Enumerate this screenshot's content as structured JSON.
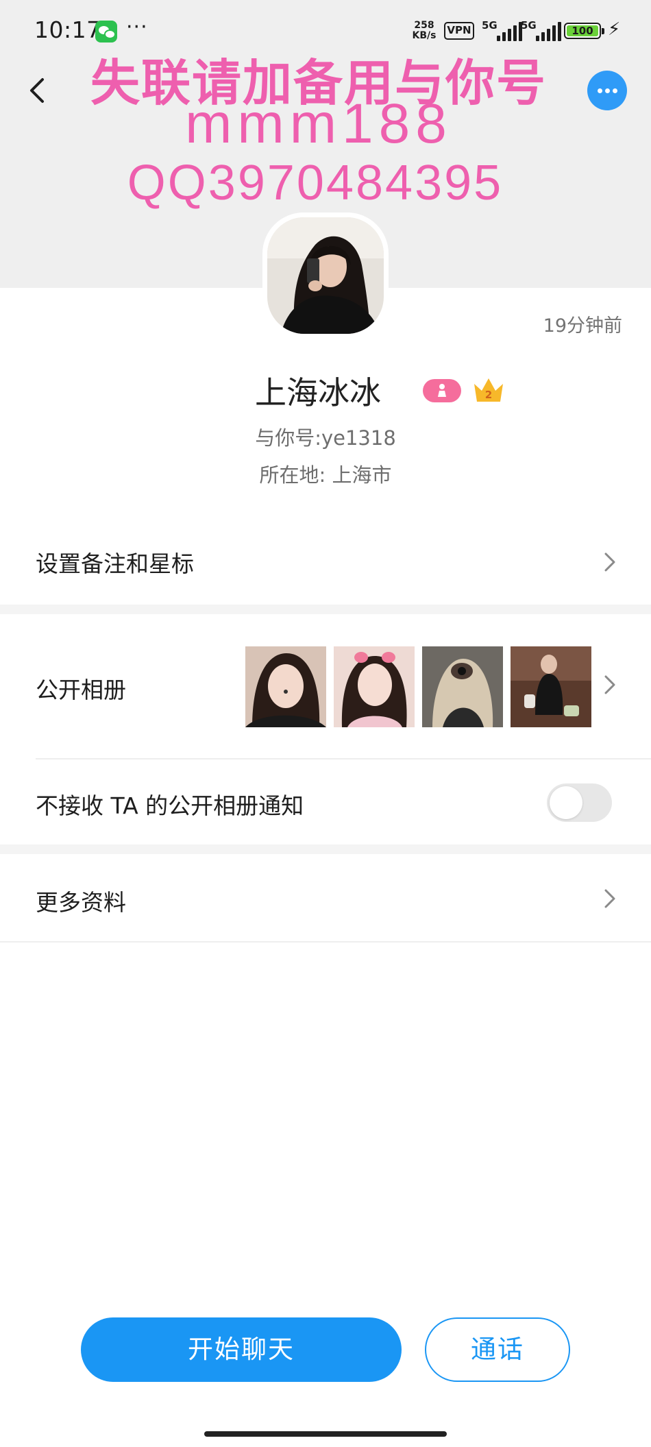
{
  "status_bar": {
    "time": "10:17",
    "more": "···",
    "net_speed_value": "258",
    "net_speed_unit": "KB/s",
    "vpn": "VPN",
    "signal1_label": "5G",
    "signal2_label": "5G",
    "battery": "100",
    "wechat_icon": "wechat-icon",
    "charging_icon": "bolt-icon"
  },
  "nav": {
    "back_icon": "chevron-left-icon",
    "more_icon": "ellipsis-icon",
    "accent_color": "#2f9bf7"
  },
  "watermark": {
    "line1": "失联请加备用与你号",
    "line2": "mmm188",
    "line3": "QQ3970484395",
    "color": "#ee5fae"
  },
  "profile": {
    "last_seen": "19分钟前",
    "nickname": "上海冰冰",
    "account_id": "与你号:ye1318",
    "location": "所在地: 上海市",
    "gender_badge_icon": "female-icon",
    "level_badge": "2",
    "level_badge_icon": "crown-icon"
  },
  "menu": {
    "remark_label": "设置备注和星标",
    "album_label": "公开相册",
    "album_notify_label": "不接收 TA 的公开相册通知",
    "album_notify_on": false,
    "more_info_label": "更多资料"
  },
  "actions": {
    "chat_label": "开始聊天",
    "call_label": "通话",
    "primary_color": "#1a96f4"
  }
}
